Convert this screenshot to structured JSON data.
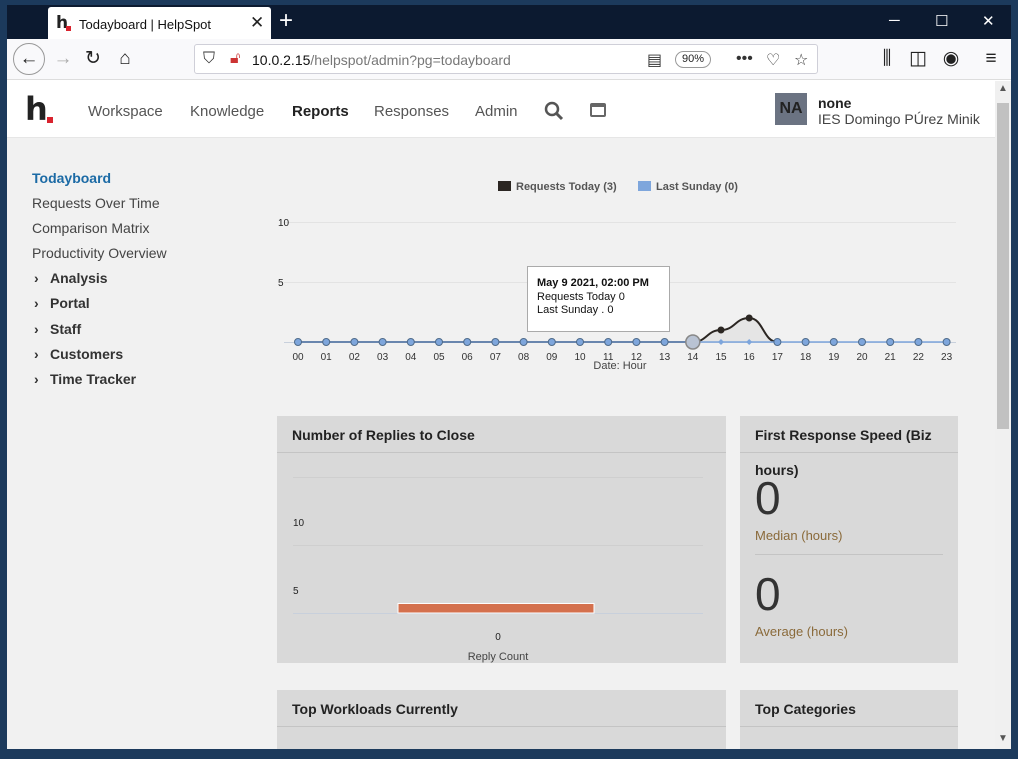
{
  "browser": {
    "tab_title": "Todayboard | HelpSpot",
    "tab_favicon": "h",
    "tab_close": "✕",
    "new_tab": "+",
    "url_host": "10.0.2.15",
    "url_path": "/helpspot/admin?pg=todayboard",
    "zoom": "90%"
  },
  "app": {
    "logo": "h",
    "nav": [
      "Workspace",
      "Knowledge",
      "Reports",
      "Responses",
      "Admin"
    ],
    "active_nav": "Reports",
    "user": {
      "initials": "NA",
      "name": "none",
      "org": "IES Domingo PÚrez Minik"
    }
  },
  "sidebar": {
    "links": [
      "Todayboard",
      "Requests Over Time",
      "Comparison Matrix",
      "Productivity Overview"
    ],
    "groups": [
      "Analysis",
      "Portal",
      "Staff",
      "Customers",
      "Time Tracker"
    ]
  },
  "today_chart": {
    "legend": [
      {
        "label": "Requests Today (3)",
        "color": "#2b2622"
      },
      {
        "label": "Last Sunday (0)",
        "color": "#7ea6dc"
      }
    ],
    "x_title": "Date: Hour",
    "y_ticks": [
      "10",
      "5"
    ],
    "tooltip": {
      "title": "May 9 2021, 02:00 PM",
      "line1": "Requests Today 0",
      "line2": "Last Sunday . 0"
    }
  },
  "chart_data": [
    {
      "type": "area",
      "title": "",
      "xlabel": "Date: Hour",
      "ylabel": "",
      "x": [
        "00",
        "01",
        "02",
        "03",
        "04",
        "05",
        "06",
        "07",
        "08",
        "09",
        "10",
        "11",
        "12",
        "13",
        "14",
        "15",
        "16",
        "17",
        "18",
        "19",
        "20",
        "21",
        "22",
        "23"
      ],
      "ylim": [
        0,
        10
      ],
      "series": [
        {
          "name": "Requests Today (3)",
          "color": "#2b2622",
          "values": [
            0,
            0,
            0,
            0,
            0,
            0,
            0,
            0,
            0,
            0,
            0,
            0,
            0,
            0,
            0,
            1,
            2,
            0,
            null,
            null,
            null,
            null,
            null,
            null
          ]
        },
        {
          "name": "Last Sunday (0)",
          "color": "#7ea6dc",
          "values": [
            0,
            0,
            0,
            0,
            0,
            0,
            0,
            0,
            0,
            0,
            0,
            0,
            0,
            0,
            0,
            0,
            0,
            0,
            0,
            0,
            0,
            0,
            0,
            0
          ]
        }
      ]
    },
    {
      "type": "bar",
      "title": "Number of Replies to Close",
      "categories": [
        "0"
      ],
      "values": [
        0.7
      ],
      "xlabel": "Reply Count",
      "ylim": [
        0,
        10
      ],
      "color": "#d4704d"
    }
  ],
  "replies_panel": {
    "title": "Number of Replies to Close",
    "y_ticks": [
      "10",
      "5"
    ],
    "x_tick": "0",
    "x_title": "Reply Count"
  },
  "speed_panel": {
    "title_line1": "First Response Speed (Biz",
    "title_line2": "hours)",
    "median_value": "0",
    "median_label": "Median (hours)",
    "average_value": "0",
    "average_label": "Average (hours)"
  },
  "workloads_panel": {
    "title": "Top Workloads Currently"
  },
  "categories_panel": {
    "title": "Top Categories"
  }
}
